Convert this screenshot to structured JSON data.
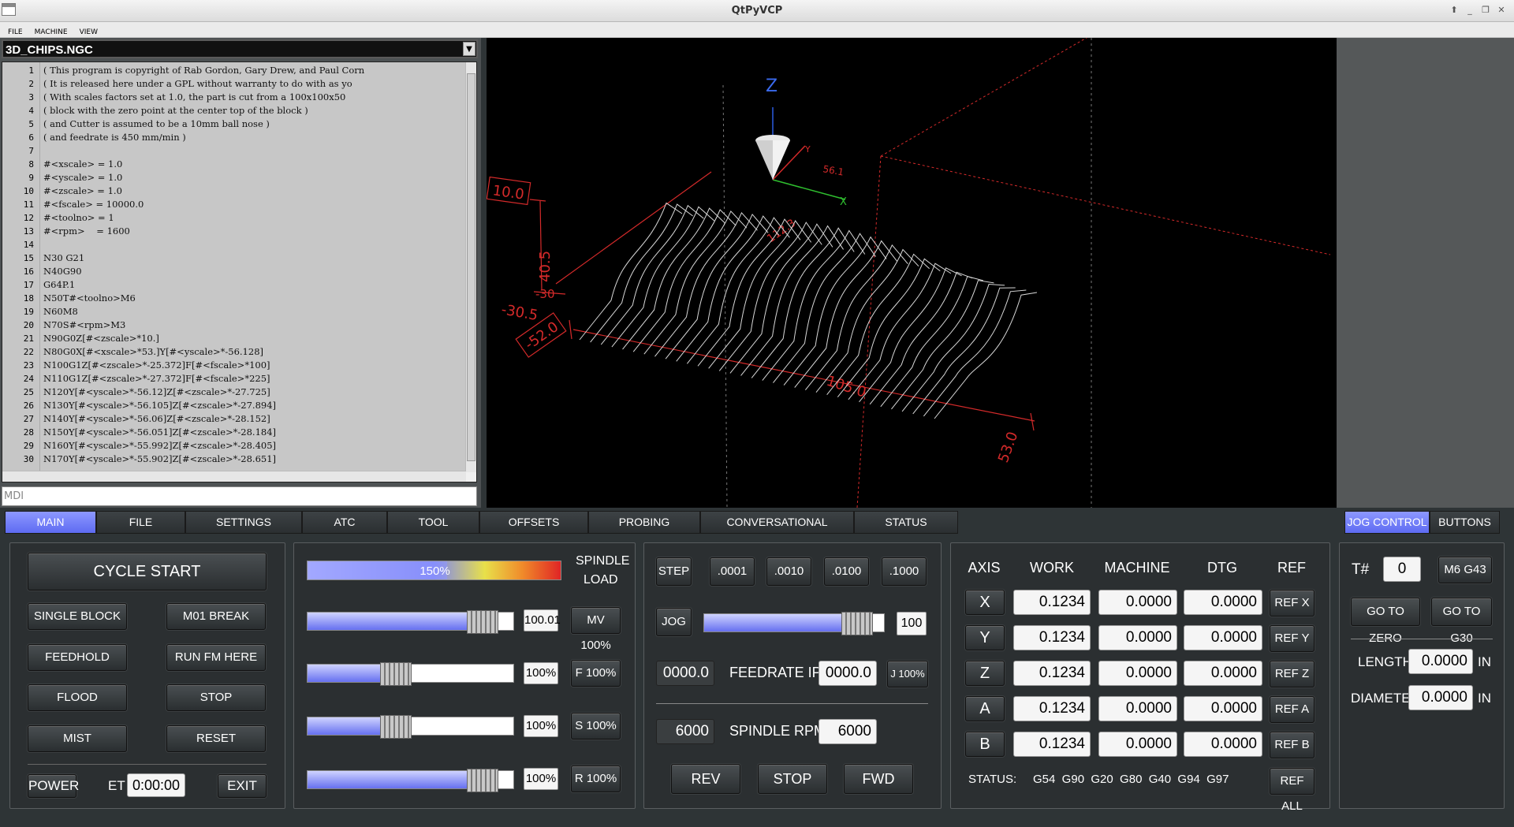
{
  "window": {
    "title": "QtPyVCP"
  },
  "menu": [
    "FILE",
    "MACHINE",
    "VIEW"
  ],
  "file": {
    "name": "3D_CHIPS.NGC"
  },
  "editor": {
    "lines": [
      {
        "n": "1",
        "t": "( This program is copyright of Rab Gordon, Gary Drew, and Paul Corn"
      },
      {
        "n": "2",
        "t": "( It is released here under a GPL without warranty to do with as yo"
      },
      {
        "n": "3",
        "t": "( With scales factors set at 1.0, the part is cut from a 100x100x50"
      },
      {
        "n": "4",
        "t": "( block with the zero point at the center top of the block )"
      },
      {
        "n": "5",
        "t": "( and Cutter is assumed to be a 10mm ball nose )"
      },
      {
        "n": "6",
        "t": "( and feedrate is 450 mm/min )"
      },
      {
        "n": "7",
        "t": ""
      },
      {
        "n": "8",
        "t": "#<xscale> = 1.0"
      },
      {
        "n": "9",
        "t": "#<yscale> = 1.0"
      },
      {
        "n": "10",
        "t": "#<zscale> = 1.0"
      },
      {
        "n": "11",
        "t": "#<fscale> = 10000.0"
      },
      {
        "n": "12",
        "t": "#<toolno> = 1"
      },
      {
        "n": "13",
        "t": "#<rpm>    = 1600"
      },
      {
        "n": "14",
        "t": ""
      },
      {
        "n": "15",
        "t": "N30 G21"
      },
      {
        "n": "16",
        "t": "N40G90"
      },
      {
        "n": "17",
        "t": "G64P.1"
      },
      {
        "n": "18",
        "t": "N50T#<toolno>M6"
      },
      {
        "n": "19",
        "t": "N60M8"
      },
      {
        "n": "20",
        "t": "N70S#<rpm>M3"
      },
      {
        "n": "21",
        "t": "N90G0Z[#<zscale>*10.]"
      },
      {
        "n": "22",
        "t": "N80G0X[#<xscale>*53.]Y[#<yscale>*-56.128]"
      },
      {
        "n": "23",
        "t": "N100G1Z[#<zscale>*-25.372]F[#<fscale>*100]"
      },
      {
        "n": "24",
        "t": "N110G1Z[#<zscale>*-27.372]F[#<fscale>*225]"
      },
      {
        "n": "25",
        "t": "N120Y[#<yscale>*-56.12]Z[#<zscale>*-27.725]"
      },
      {
        "n": "26",
        "t": "N130Y[#<yscale>*-56.105]Z[#<zscale>*-27.894]"
      },
      {
        "n": "27",
        "t": "N140Y[#<yscale>*-56.06]Z[#<zscale>*-28.152]"
      },
      {
        "n": "28",
        "t": "N150Y[#<yscale>*-56.051]Z[#<zscale>*-28.184]"
      },
      {
        "n": "29",
        "t": "N160Y[#<yscale>*-55.992]Z[#<zscale>*-28.405]"
      },
      {
        "n": "30",
        "t": "N170Y[#<yscale>*-55.902]Z[#<zscale>*-28.651]"
      }
    ]
  },
  "mdi": {
    "placeholder": "MDI"
  },
  "view3d": {
    "axis_z": "Z",
    "axis_x": "X",
    "dims": [
      "10.0",
      "40.5",
      "-30.5",
      "-52.0",
      "105.0",
      "53.0",
      "112.3",
      "56.1",
      "-30"
    ]
  },
  "tabs": [
    "MAIN",
    "FILE",
    "SETTINGS",
    "ATC",
    "TOOL",
    "OFFSETS",
    "PROBING",
    "CONVERSATIONAL",
    "STATUS"
  ],
  "right_tabs": [
    "JOG CONTROL",
    "BUTTONS"
  ],
  "control": {
    "cycle_start": "CYCLE START",
    "single_block": "SINGLE BLOCK",
    "m01_break": "M01 BREAK",
    "feedhold": "FEEDHOLD",
    "run_from_here": "RUN FM HERE",
    "flood": "FLOOD",
    "stop": "STOP",
    "mist": "MIST",
    "reset": "RESET",
    "power": "POWER",
    "et_label": "ET",
    "et_value": "0:00:00",
    "exit": "EXIT"
  },
  "overrides": {
    "spindle_load_label1": "SPINDLE",
    "spindle_load_label2": "LOAD",
    "spindle_load_value": "150%",
    "spindle_load_level": 0.55,
    "rows": [
      {
        "value": "100.01",
        "button": "MV 100%",
        "level": 0.85
      },
      {
        "value": "100%",
        "button": "F 100%",
        "level": 0.43
      },
      {
        "value": "100%",
        "button": "S 100%",
        "level": 0.43
      },
      {
        "value": "100%",
        "button": "R 100%",
        "level": 0.85
      }
    ]
  },
  "jog": {
    "step": "STEP",
    "increments": [
      ".0001",
      ".0010",
      ".0100",
      ".1000"
    ],
    "jog": "JOG",
    "jog_value": "100",
    "jog_level": 0.85,
    "feed_current": "0000.0",
    "feedrate_label": "FEEDRATE IPM",
    "feed_set": "0000.0",
    "j100": "J 100%",
    "spindle_current": "6000",
    "spindle_label": "SPINDLE RPM",
    "spindle_set": "6000",
    "rev": "REV",
    "stop": "STOP",
    "fwd": "FWD"
  },
  "dro": {
    "headers": [
      "AXIS",
      "WORK",
      "MACHINE",
      "DTG",
      "REF"
    ],
    "rows": [
      {
        "axis": "X",
        "work": "0.1234",
        "machine": "0.0000",
        "dtg": "0.0000",
        "ref": "REF X"
      },
      {
        "axis": "Y",
        "work": "0.1234",
        "machine": "0.0000",
        "dtg": "0.0000",
        "ref": "REF Y"
      },
      {
        "axis": "Z",
        "work": "0.1234",
        "machine": "0.0000",
        "dtg": "0.0000",
        "ref": "REF Z"
      },
      {
        "axis": "A",
        "work": "0.1234",
        "machine": "0.0000",
        "dtg": "0.0000",
        "ref": "REF A"
      },
      {
        "axis": "B",
        "work": "0.1234",
        "machine": "0.0000",
        "dtg": "0.0000",
        "ref": "REF B"
      }
    ],
    "status_label": "STATUS:",
    "gcodes": "G54  G90  G20  G80  G40  G94  G97",
    "ref_all": "REF ALL"
  },
  "tool": {
    "tnum_label": "T#",
    "tnum": "0",
    "m6g43": "M6 G43",
    "go_zero": "GO TO ZERO",
    "go_g30": "GO TO G30",
    "length_label": "LENGTH",
    "length": "0.0000",
    "diameter_label": "DIAMETER",
    "diameter": "0.0000",
    "unit": "IN"
  },
  "colors": {
    "accent": "#6672f5",
    "view_dims": "#d42a2a",
    "toolpath": "#d8d8d8"
  }
}
